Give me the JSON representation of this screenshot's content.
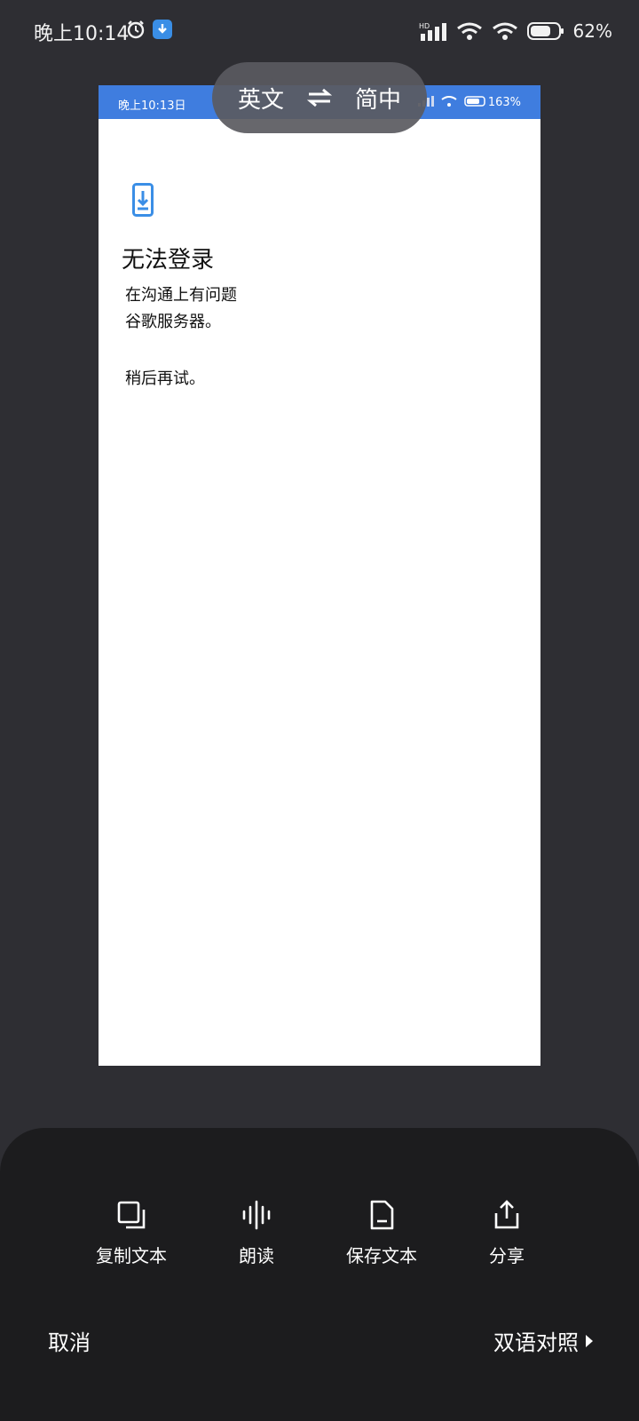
{
  "status_bar": {
    "time": "晚上10:14",
    "battery_percent": "62%",
    "alarm_icon": "alarm-icon",
    "download_icon": "download-app-icon"
  },
  "translation_preview": {
    "status_time": "晚上10:13日",
    "status_percent": "163%",
    "title": "无法登录",
    "lines": [
      "在沟通上有问题",
      "谷歌服务器。",
      "稍后再试。"
    ]
  },
  "language_switch": {
    "source": "英文",
    "target": "简中",
    "swap_icon": "swap-arrows-icon"
  },
  "actions": [
    {
      "label": "复制文本",
      "icon": "copy-icon"
    },
    {
      "label": "朗读",
      "icon": "sound-wave-icon"
    },
    {
      "label": "保存文本",
      "icon": "document-icon"
    },
    {
      "label": "分享",
      "icon": "share-icon"
    }
  ],
  "footer": {
    "cancel": "取消",
    "bilingual": "双语对照"
  },
  "colors": {
    "background": "#2e2e33",
    "sheet": "#1c1c1e",
    "preview_status": "#3f7ddf",
    "accent_icon": "#3a8ee6"
  }
}
